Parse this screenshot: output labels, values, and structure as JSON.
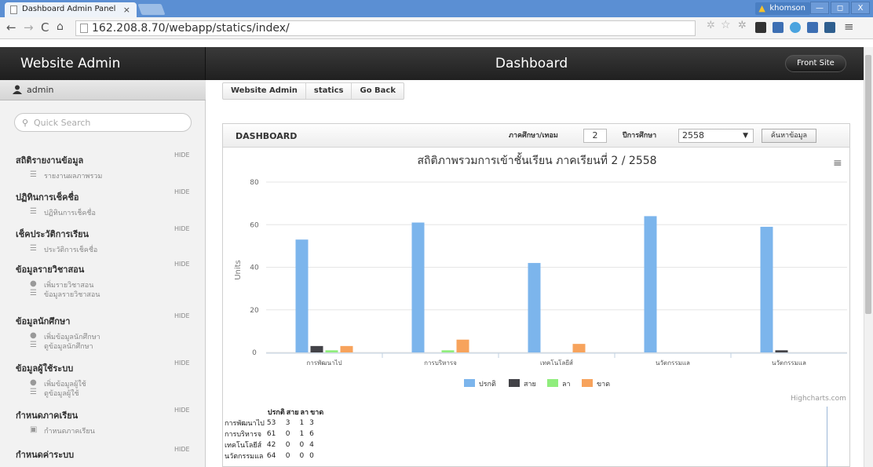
{
  "browser": {
    "tab_title": "Dashboard Admin Panel",
    "tab_close": "×",
    "url": "162.208.8.70/webapp/statics/index/",
    "user": "khomson",
    "win_buttons": [
      "—",
      "◻",
      "X"
    ]
  },
  "header": {
    "brand": "Website Admin",
    "title": "Dashboard",
    "front_site": "Front Site"
  },
  "sidebar": {
    "user": "admin",
    "search_placeholder": "Quick Search",
    "hide_label": "HIDE",
    "sections": [
      {
        "title": "สถิติรายงานข้อมูล",
        "items": [
          {
            "label": "รายงานผลภาพรวม",
            "icon": "list-icon"
          }
        ]
      },
      {
        "title": "ปฏิทินการเช็คชื่อ",
        "items": [
          {
            "label": "ปฏิทินการเช็คชื่อ",
            "icon": "list-icon"
          }
        ]
      },
      {
        "title": "เช็คประวัติการเรียน",
        "items": [
          {
            "label": "ประวัติการเช็คชื่อ",
            "icon": "list-icon"
          }
        ]
      },
      {
        "title": "ข้อมูลรายวิชาสอน",
        "items": [
          {
            "label": "เพิ่มรายวิชาสอน",
            "icon": "user-add-icon"
          },
          {
            "label": "ข้อมูลรายวิชาสอน",
            "icon": "list-icon"
          }
        ]
      },
      {
        "title": "ข้อมูลนักศึกษา",
        "items": [
          {
            "label": "เพิ่มข้อมูลนักศึกษา",
            "icon": "user-add-icon"
          },
          {
            "label": "ดูข้อมูลนักศึกษา",
            "icon": "list-icon"
          }
        ]
      },
      {
        "title": "ข้อมูลผู้ใช้ระบบ",
        "items": [
          {
            "label": "เพิ่มข้อมูลผู้ใช้",
            "icon": "user-add-icon"
          },
          {
            "label": "ดูข้อมูลผู้ใช้",
            "icon": "list-icon"
          }
        ]
      },
      {
        "title": "กำหนดภาคเรียน",
        "items": [
          {
            "label": "กำหนดภาคเรียน",
            "icon": "building-icon"
          }
        ]
      },
      {
        "title": "กำหนดค่าระบบ",
        "items": []
      }
    ]
  },
  "breadcrumb": [
    "Website Admin",
    "statics",
    "Go Back"
  ],
  "panel": {
    "title": "DASHBOARD",
    "term_label": "ภาคศึกษา/เทอม",
    "term_value": "2",
    "year_label": "ปีการศึกษา",
    "year_value": "2558",
    "search_button": "ค้นหาข้อมูล",
    "credit": "Highcharts.com"
  },
  "chart_data": {
    "type": "bar",
    "title": "สถิติภาพรวมการเข้าชั้นเรียน ภาคเรียนที่ 2 / 2558",
    "ylabel": "Units",
    "ylim": [
      0,
      80
    ],
    "yticks": [
      0,
      20,
      40,
      60,
      80
    ],
    "categories": [
      "การพัฒนาไป",
      "การบริหารจ",
      "เทคโนโลยีส์",
      "นวัตกรรมแล",
      "นวัตกรรมแล"
    ],
    "series": [
      {
        "name": "ปรกติ",
        "color": "#7cb5ec",
        "values": [
          53,
          61,
          42,
          64,
          59
        ]
      },
      {
        "name": "สาย",
        "color": "#434348",
        "values": [
          3,
          0,
          0,
          0,
          1
        ]
      },
      {
        "name": "ลา",
        "color": "#90ed7d",
        "values": [
          1,
          1,
          0,
          0,
          0
        ]
      },
      {
        "name": "ขาด",
        "color": "#f7a35c",
        "values": [
          3,
          6,
          4,
          0,
          0
        ]
      }
    ]
  },
  "data_table": {
    "headers": [
      "",
      "ปรกติ",
      "สาย",
      "ลา",
      "ขาด"
    ],
    "rows": [
      [
        "การพัฒนาไป",
        "53",
        "3",
        "1",
        "3"
      ],
      [
        "การบริหารจ",
        "61",
        "0",
        "1",
        "6"
      ],
      [
        "เทคโนโลยีส์",
        "42",
        "0",
        "0",
        "4"
      ],
      [
        "นวัตกรรมแล",
        "64",
        "0",
        "0",
        "0"
      ]
    ]
  }
}
